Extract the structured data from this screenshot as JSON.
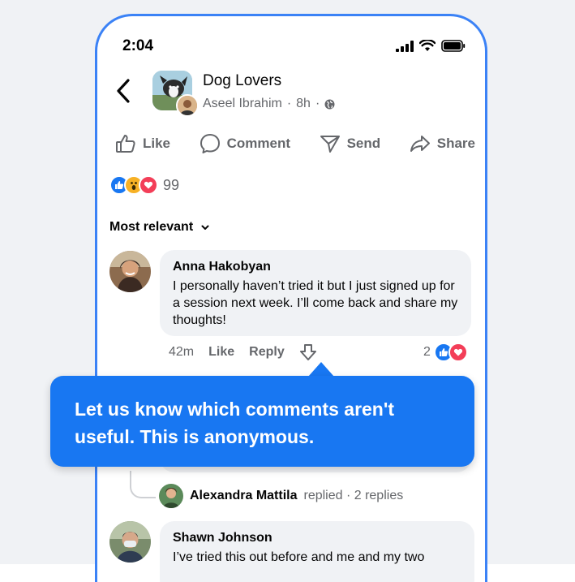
{
  "status_bar": {
    "time": "2:04"
  },
  "post": {
    "group_name": "Dog Lovers",
    "author": "Aseel Ibrahim",
    "time": "8h",
    "separator": "·"
  },
  "actions": [
    {
      "label": "Like",
      "icon": "thumbs-up-icon"
    },
    {
      "label": "Comment",
      "icon": "comment-bubble-icon"
    },
    {
      "label": "Send",
      "icon": "send-icon"
    },
    {
      "label": "Share",
      "icon": "share-arrow-icon"
    }
  ],
  "reactions": {
    "count": "99",
    "types": [
      "like",
      "wow",
      "love"
    ]
  },
  "sort": {
    "label": "Most relevant"
  },
  "comments": [
    {
      "name": "Anna Hakobyan",
      "text": "I personally haven’t tried it but I just signed up for a session next week. I’ll come back and share my thoughts!",
      "time": "42m",
      "like": "Like",
      "reply": "Reply",
      "reaction_count": "2"
    },
    {
      "name": "Shawn Johnson",
      "text": "I’ve tried this out before and me and my two"
    }
  ],
  "replies_summary": {
    "name": "Alexandra Mattila",
    "text": "replied · 2 replies"
  },
  "tooltip": {
    "text": "Let us know which comments aren't useful. This is anonymous."
  },
  "colors": {
    "accent": "#1877f2",
    "frame": "#3b82f6",
    "love": "#f33e58",
    "wow": "#f7b125"
  }
}
